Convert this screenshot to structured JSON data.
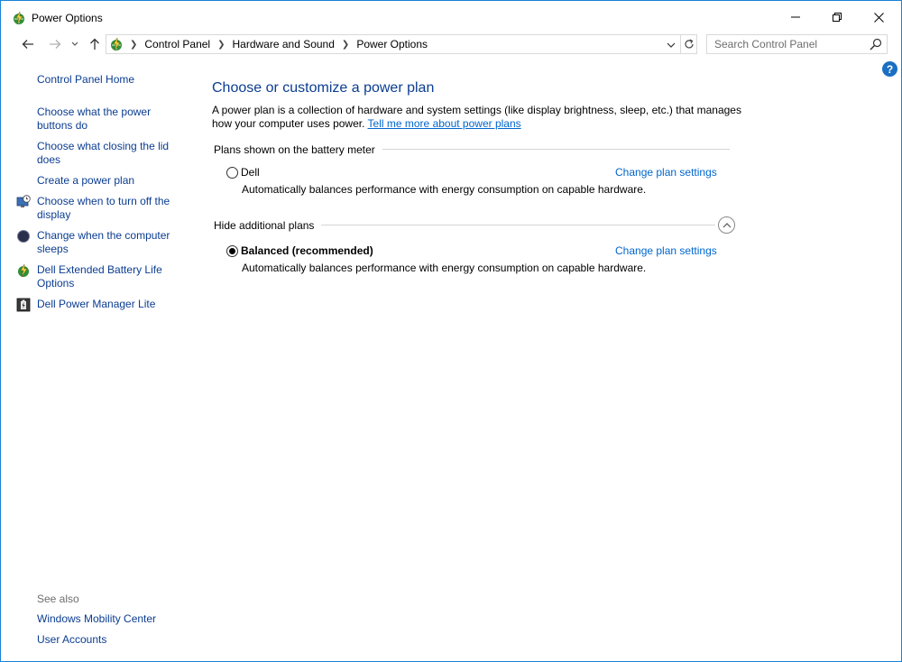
{
  "window": {
    "title": "Power Options"
  },
  "address_bar": {
    "crumbs": [
      "Control Panel",
      "Hardware and Sound",
      "Power Options"
    ]
  },
  "search": {
    "placeholder": "Search Control Panel"
  },
  "left_pane": {
    "home_label": "Control Panel Home",
    "links": [
      {
        "label": "Choose what the power buttons do"
      },
      {
        "label": "Choose what closing the lid does"
      },
      {
        "label": "Create a power plan"
      },
      {
        "label": "Choose when to turn off the display",
        "icon": "display-clock-icon"
      },
      {
        "label": "Change when the computer sleeps",
        "icon": "moon-icon"
      },
      {
        "label": "Dell Extended Battery Life Options",
        "icon": "power-plan-icon"
      },
      {
        "label": "Dell Power Manager Lite",
        "icon": "battery-manager-icon"
      }
    ],
    "see_also_label": "See also",
    "see_also_links": [
      "Windows Mobility Center",
      "User Accounts"
    ]
  },
  "main": {
    "title": "Choose or customize a power plan",
    "intro_text": "A power plan is a collection of hardware and system settings (like display brightness, sleep, etc.) that manages how your computer uses power.",
    "intro_link": "Tell me more about power plans",
    "battery_section_label": "Plans shown on the battery meter",
    "hidden_section_label": "Hide additional plans",
    "plans": [
      {
        "name": "Dell",
        "description": "Automatically balances performance with energy consumption on capable hardware.",
        "selected": false,
        "change_label": "Change plan settings"
      },
      {
        "name": "Balanced (recommended)",
        "description": "Automatically balances performance with energy consumption on capable hardware.",
        "selected": true,
        "change_label": "Change plan settings"
      }
    ]
  },
  "colors": {
    "link": "#0066cc",
    "heading": "#0b3d91",
    "window_border": "#1883d7",
    "help_badge": "#1a6fc2"
  }
}
